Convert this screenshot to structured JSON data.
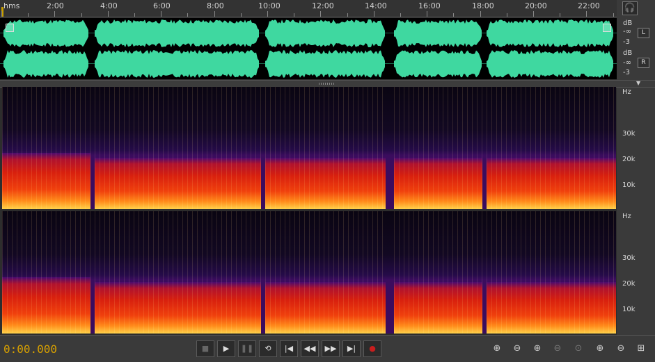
{
  "ruler": {
    "unit": "hms",
    "labels": [
      "2:00",
      "4:00",
      "6:00",
      "8:00",
      "10:00",
      "12:00",
      "14:00",
      "16:00",
      "18:00",
      "20:00",
      "22:00"
    ]
  },
  "right_panel": {
    "headphones_icon": "headphones-icon",
    "waveform_channels": [
      {
        "button": "L",
        "db_label": "dB",
        "db_top": "-∞",
        "db_bottom": "-3"
      },
      {
        "button": "R",
        "db_label": "dB",
        "db_top": "-∞",
        "db_bottom": "-3"
      }
    ],
    "spectrogram_scales": [
      {
        "unit": "Hz",
        "ticks": [
          "30k",
          "20k",
          "10k"
        ]
      },
      {
        "unit": "Hz",
        "ticks": [
          "30k",
          "20k",
          "10k"
        ]
      }
    ]
  },
  "colors": {
    "waveform": "#3fd8a0",
    "time_display": "#d9a100",
    "record": "#c81e1e"
  },
  "transport": {
    "time": "0:00.000",
    "buttons": [
      {
        "name": "stop-button",
        "icon": "stop-icon",
        "glyph": "■",
        "enabled": false
      },
      {
        "name": "play-button",
        "icon": "play-icon",
        "glyph": "▶",
        "enabled": true
      },
      {
        "name": "pause-button",
        "icon": "pause-icon",
        "glyph": "❚❚",
        "enabled": false
      },
      {
        "name": "loop-button",
        "icon": "loop-icon",
        "glyph": "⟲",
        "enabled": true
      },
      {
        "name": "go-to-start-button",
        "icon": "skip-start-icon",
        "glyph": "|◀",
        "enabled": true
      },
      {
        "name": "rewind-button",
        "icon": "rewind-icon",
        "glyph": "◀◀",
        "enabled": true
      },
      {
        "name": "fast-forward-button",
        "icon": "fast-forward-icon",
        "glyph": "▶▶",
        "enabled": true
      },
      {
        "name": "go-to-end-button",
        "icon": "skip-end-icon",
        "glyph": "▶|",
        "enabled": true
      },
      {
        "name": "record-button",
        "icon": "record-icon",
        "glyph": "●",
        "enabled": true
      }
    ]
  },
  "zoom": {
    "buttons": [
      {
        "name": "zoom-in-amplitude-button",
        "icon": "zoom-in-amplitude-icon",
        "glyph": "⊕",
        "enabled": true
      },
      {
        "name": "zoom-out-amplitude-button",
        "icon": "zoom-out-amplitude-icon",
        "glyph": "⊖",
        "enabled": true
      },
      {
        "name": "zoom-in-time-button",
        "icon": "zoom-in-time-icon",
        "glyph": "⊕",
        "enabled": true
      },
      {
        "name": "zoom-out-time-button",
        "icon": "zoom-out-time-icon",
        "glyph": "⊖",
        "enabled": false
      },
      {
        "name": "zoom-selection-button",
        "icon": "zoom-selection-icon",
        "glyph": "⊙",
        "enabled": false
      },
      {
        "name": "zoom-in-point-button",
        "icon": "zoom-in-point-icon",
        "glyph": "⊕",
        "enabled": true
      },
      {
        "name": "zoom-out-full-button",
        "icon": "zoom-out-full-icon",
        "glyph": "⊖",
        "enabled": true
      },
      {
        "name": "zoom-all-button",
        "icon": "zoom-all-icon",
        "glyph": "⊞",
        "enabled": true
      }
    ]
  }
}
